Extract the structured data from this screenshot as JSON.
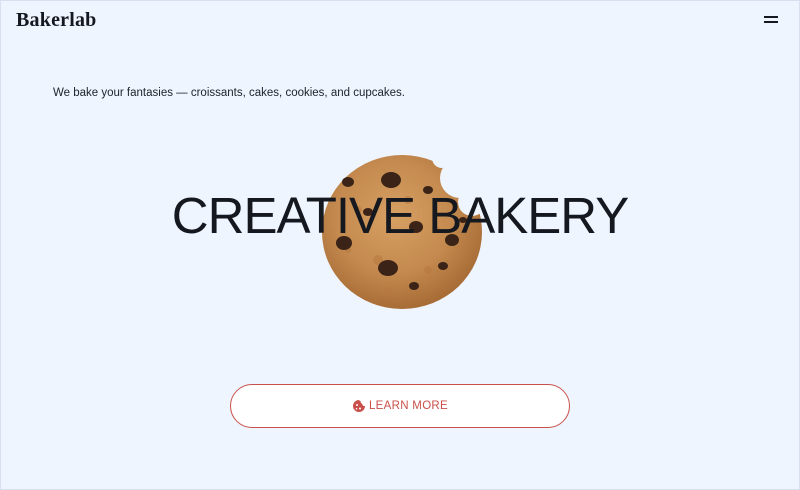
{
  "brand": {
    "name": "Bakerlab"
  },
  "header": {
    "menu_icon": "hamburger-menu-icon"
  },
  "hero": {
    "tagline": "We bake your fantasies — croissants, cakes, cookies, and cupcakes.",
    "headline": "CREATIVE BAKERY",
    "image": "cookie-image"
  },
  "cta": {
    "label": "LEARN MORE",
    "icon": "cookie-icon"
  },
  "colors": {
    "background": "#eef5ff",
    "text": "#15181f",
    "accent": "#c9504a",
    "button_bg": "#ffffff"
  }
}
